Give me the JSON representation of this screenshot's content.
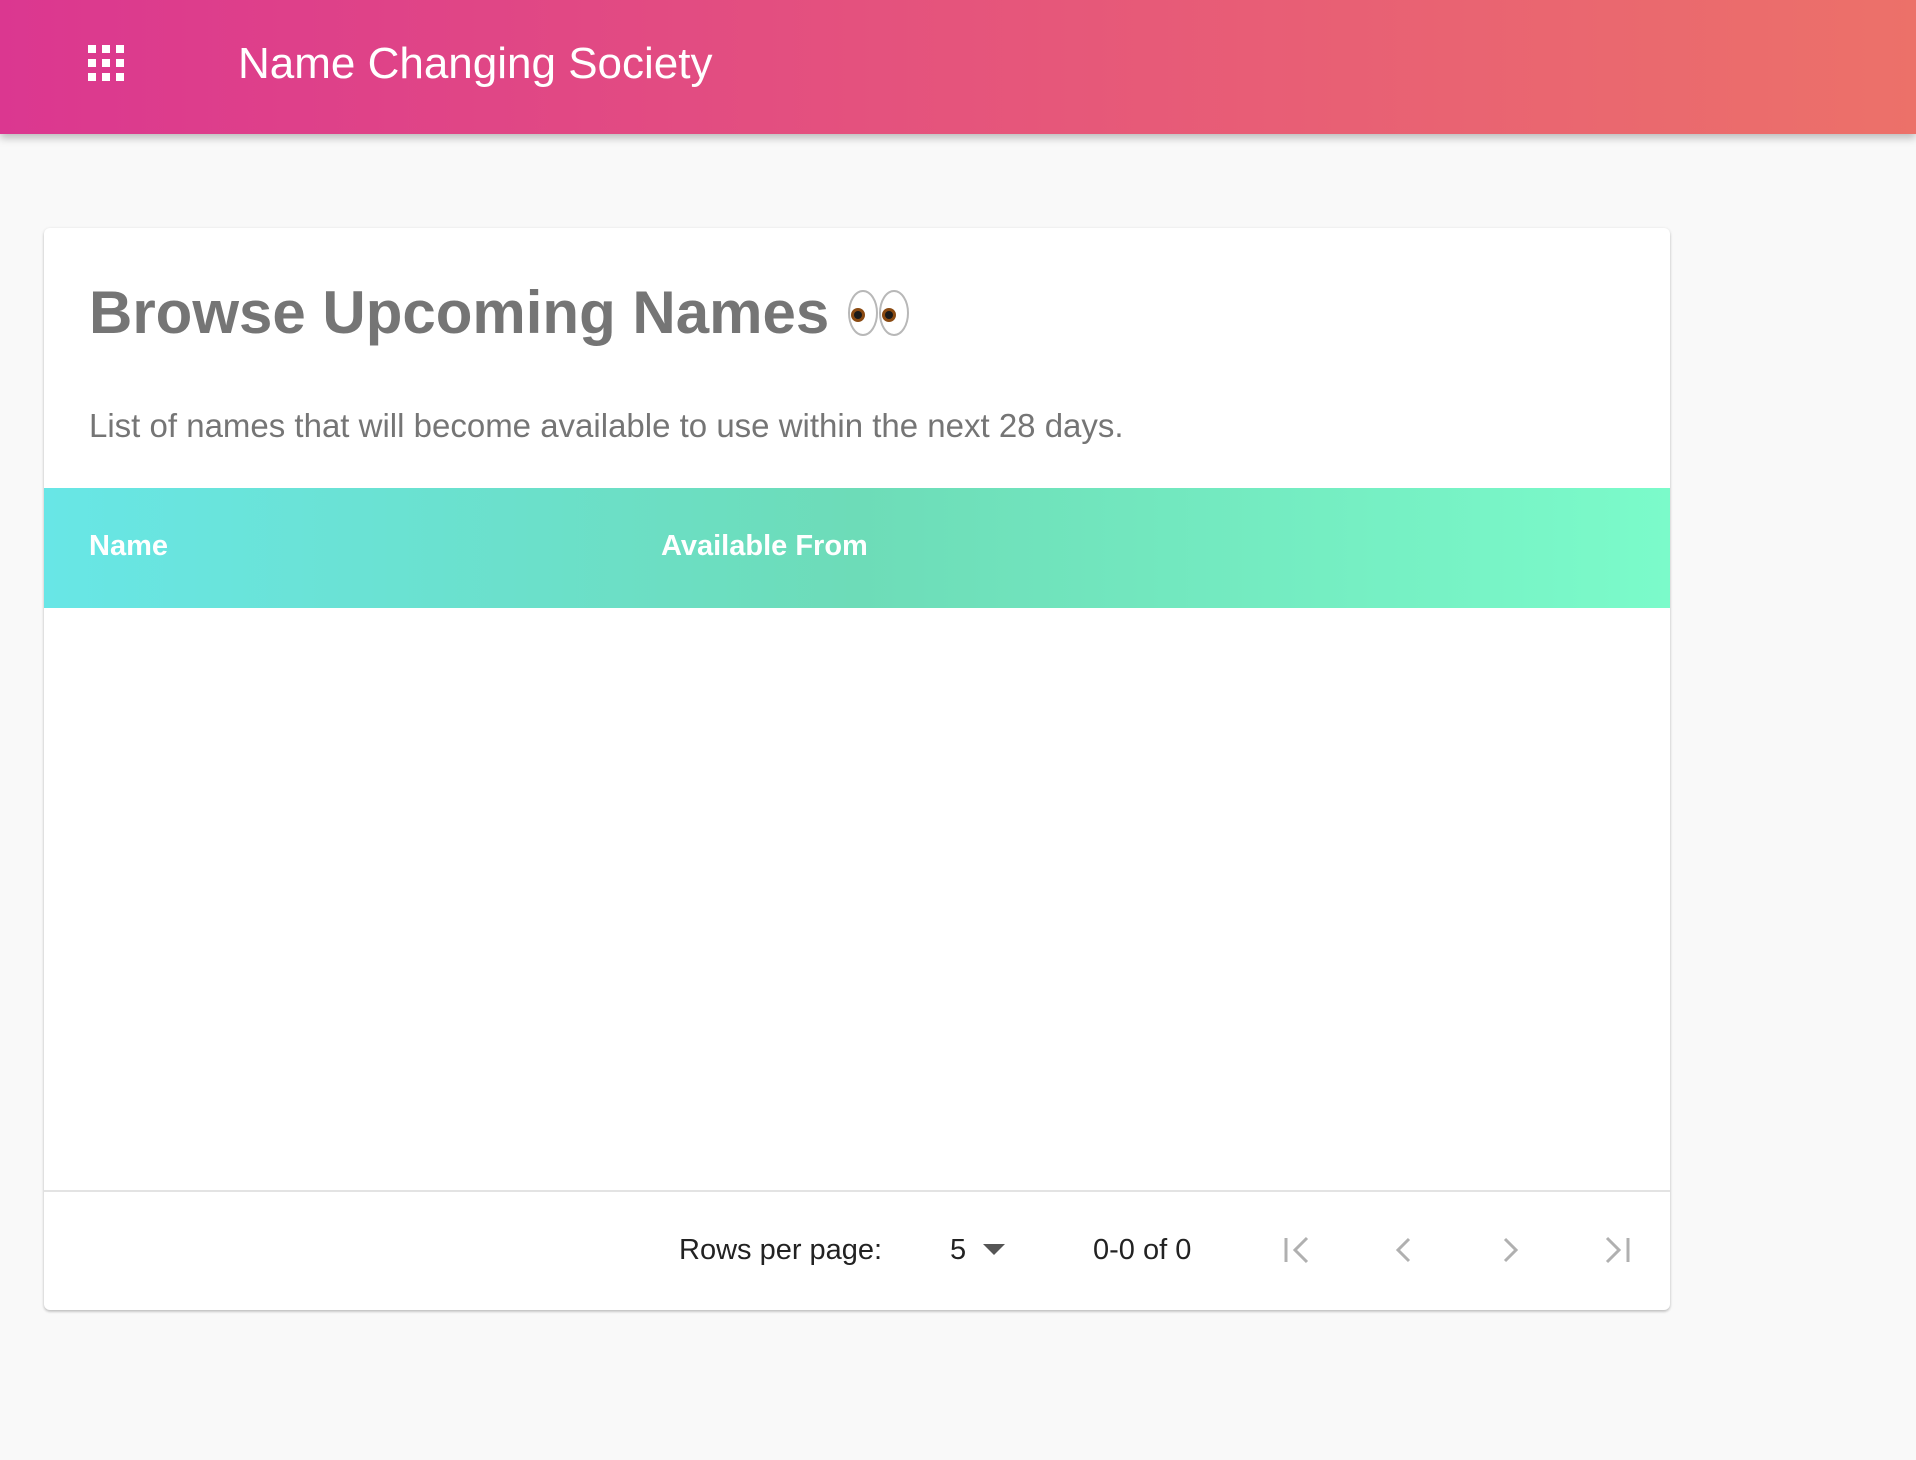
{
  "appbar": {
    "title": "Name Changing Society",
    "menu_icon": "apps-grid-icon",
    "gradient": [
      "#db3790",
      "#ec7169"
    ]
  },
  "card": {
    "title": "Browse Upcoming Names",
    "title_emoji_icon": "eyes-emoji-icon",
    "subtitle": "List of names that will become available to use within the next 28 days."
  },
  "table": {
    "columns": [
      "Name",
      "Available From"
    ],
    "rows": [],
    "header_gradient": [
      "#68e6e6",
      "#7bfbca"
    ]
  },
  "pagination": {
    "rows_per_page_label": "Rows per page:",
    "rows_per_page_value": "5",
    "range_label": "0-0 of 0",
    "icons": [
      "first-page-icon",
      "chevron-left-icon",
      "chevron-right-icon",
      "last-page-icon"
    ]
  }
}
